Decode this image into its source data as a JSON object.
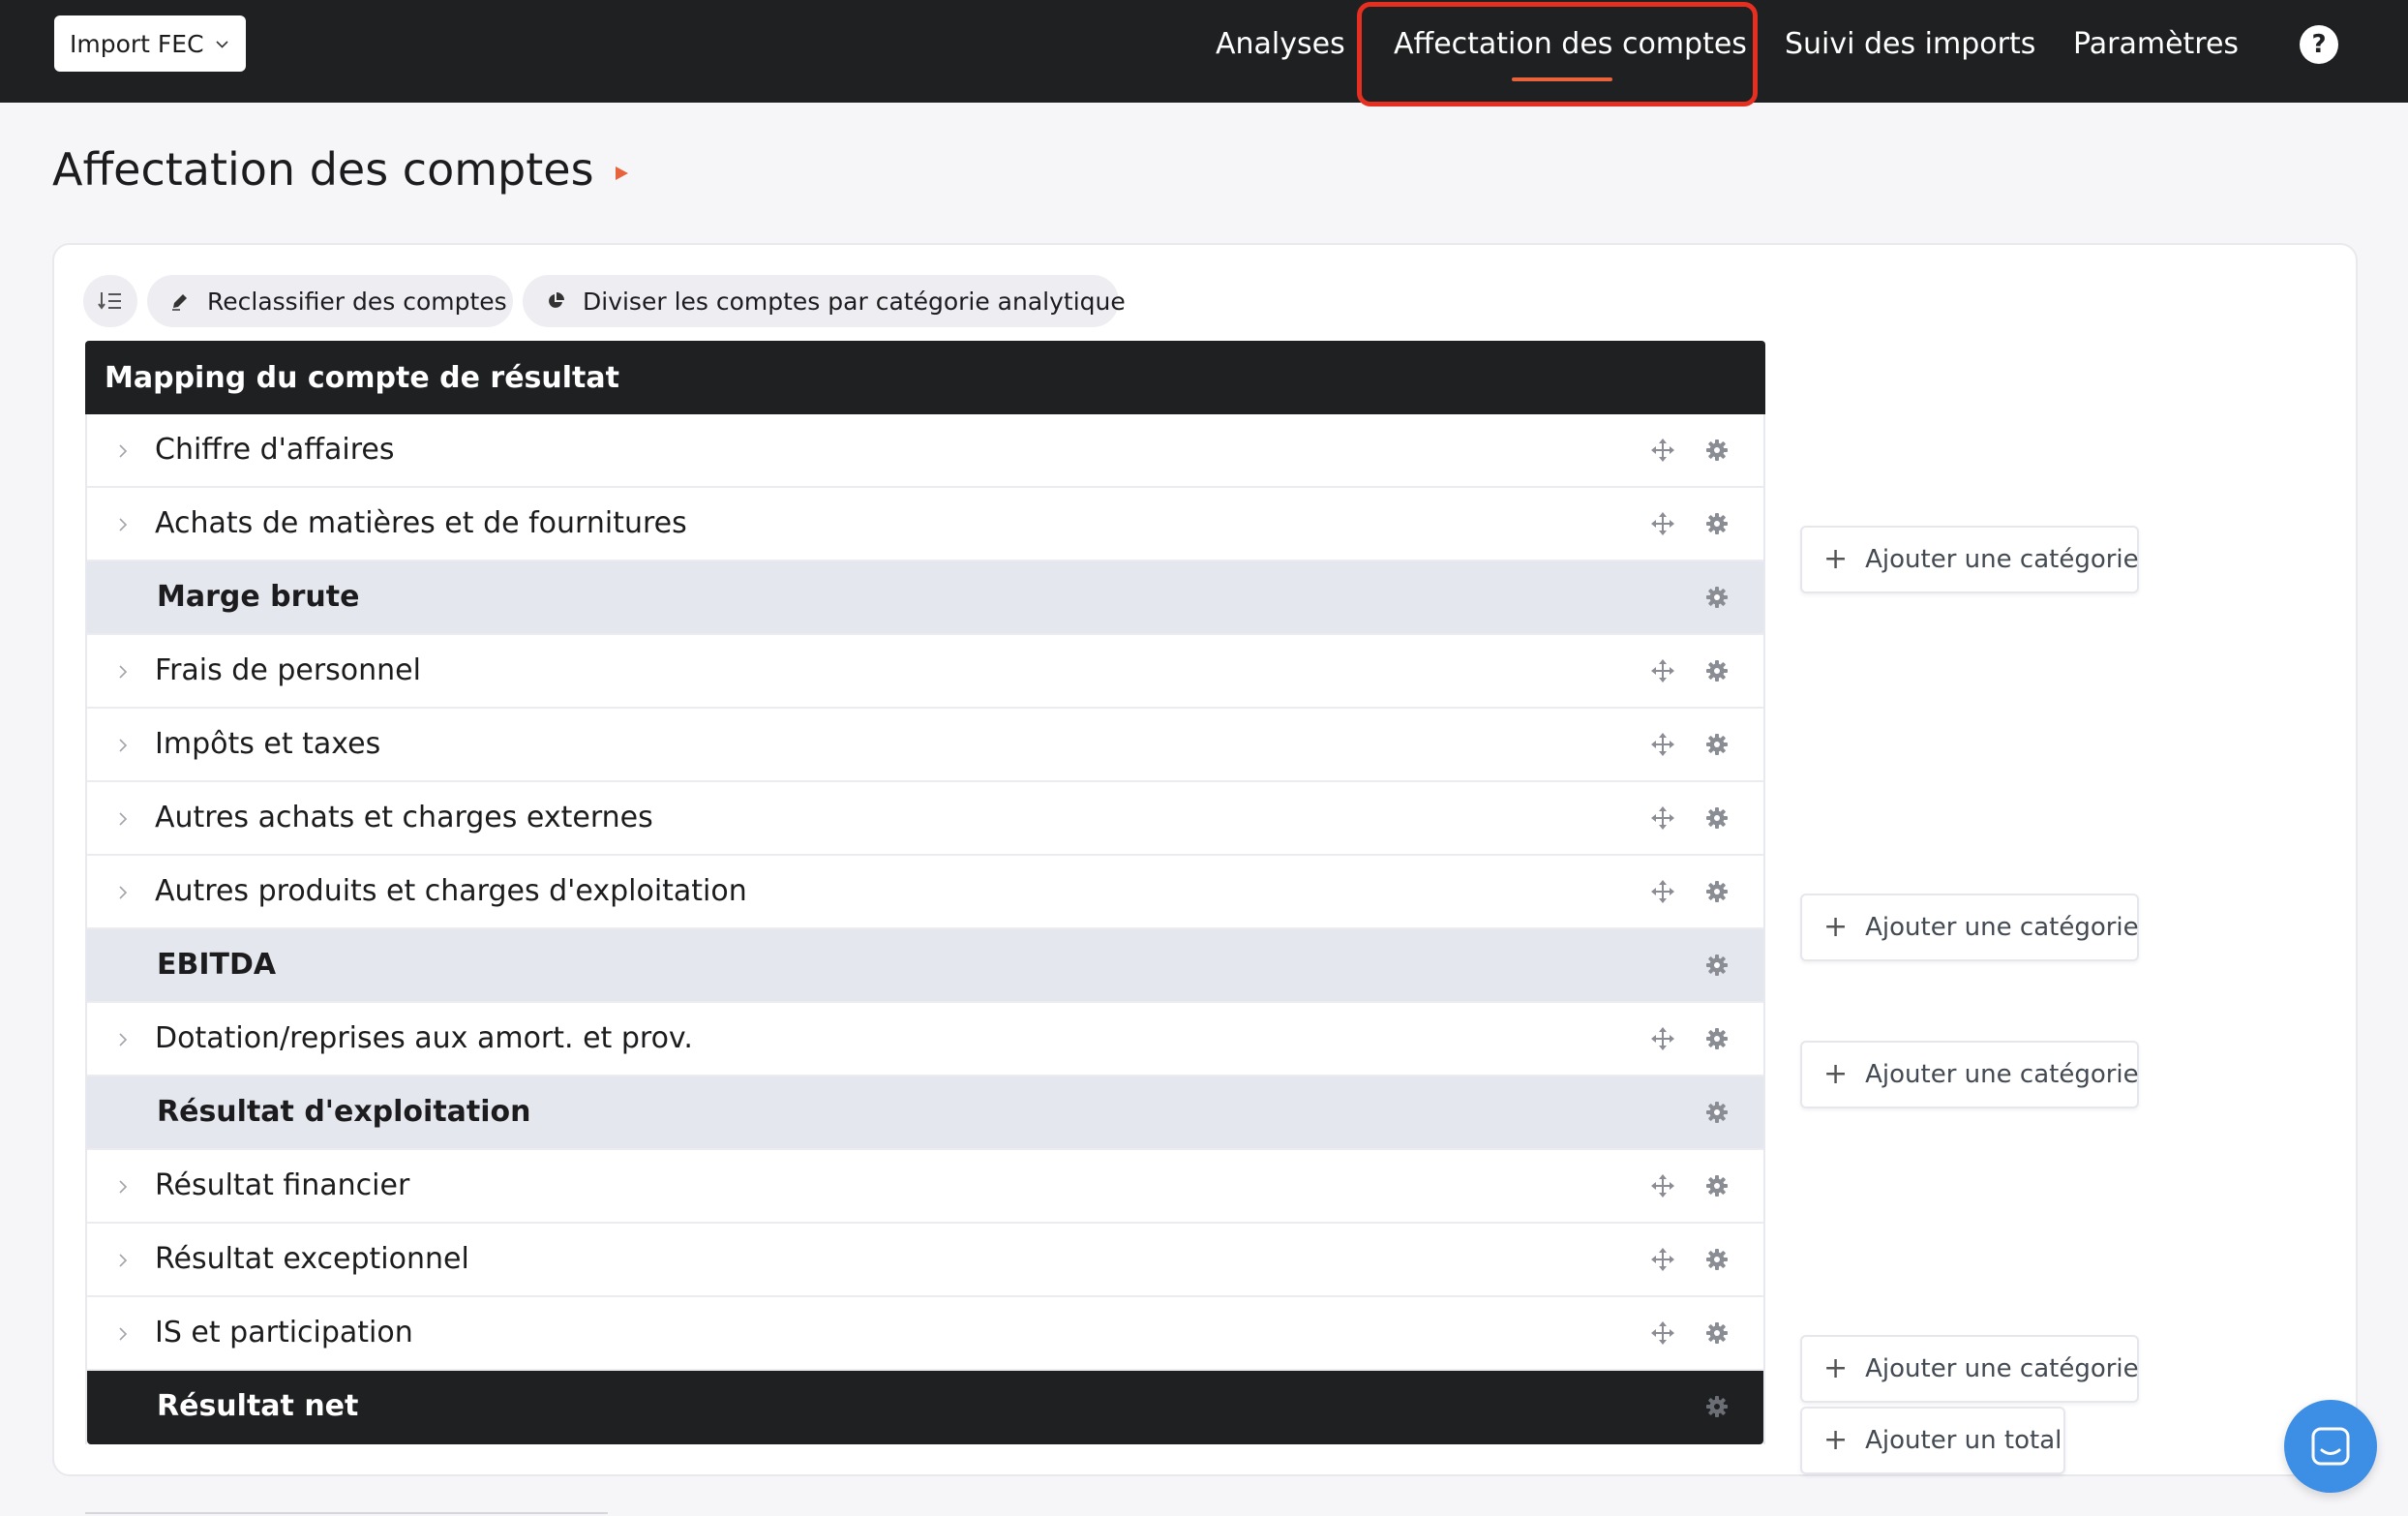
{
  "topbar": {
    "import_select": "Import FEC",
    "nav": {
      "analyses": "Analyses",
      "affectation": "Affectation des comptes",
      "suivi": "Suivi des imports",
      "parametres": "Paramètres"
    },
    "active_nav": "Affectation des comptes",
    "help": "?"
  },
  "page": {
    "title": "Affectation des comptes"
  },
  "toolbar": {
    "reclassify": "Reclassifier des comptes",
    "divide": "Diviser les comptes par catégorie analytique"
  },
  "mapping": {
    "header": "Mapping du compte de résultat",
    "rows": [
      {
        "label": "Chiffre d'affaires",
        "kind": "category"
      },
      {
        "label": "Achats de matières et de fournitures",
        "kind": "category"
      },
      {
        "label": "Marge brute",
        "kind": "total"
      },
      {
        "label": "Frais de personnel",
        "kind": "category"
      },
      {
        "label": "Impôts et taxes",
        "kind": "category"
      },
      {
        "label": "Autres achats et charges externes",
        "kind": "category"
      },
      {
        "label": "Autres produits et charges d'exploitation",
        "kind": "category"
      },
      {
        "label": "EBITDA",
        "kind": "total"
      },
      {
        "label": "Dotation/reprises aux amort. et prov.",
        "kind": "category"
      },
      {
        "label": "Résultat d'exploitation",
        "kind": "total"
      },
      {
        "label": "Résultat financier",
        "kind": "category"
      },
      {
        "label": "Résultat exceptionnel",
        "kind": "category"
      },
      {
        "label": "IS et participation",
        "kind": "category"
      },
      {
        "label": "Résultat net",
        "kind": "final"
      }
    ]
  },
  "side_actions": {
    "add_category": "Ajouter une catégorie",
    "add_total": "Ajouter un total"
  },
  "colors": {
    "nav_bg": "#1e2022",
    "accent": "#e8623c",
    "highlight": "#e52f21",
    "chat": "#3d8fe6"
  }
}
